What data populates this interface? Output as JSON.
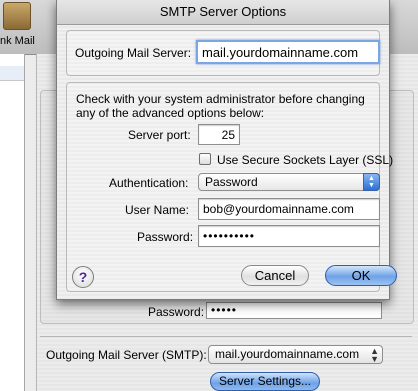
{
  "background": {
    "toolbar_label": "nk Mail",
    "password_label": "Password:",
    "password_value": "•••••",
    "smtp_label": "Outgoing Mail Server (SMTP):",
    "smtp_selected": "mail.yourdomainname.com",
    "server_settings_button": "Server Settings..."
  },
  "dialog": {
    "title": "SMTP Server Options",
    "outgoing_label": "Outgoing Mail Server:",
    "outgoing_value": "mail.yourdomainname.com",
    "note": "Check with your system administrator before changing any of the advanced options below:",
    "server_port_label": "Server port:",
    "server_port_value": "25",
    "ssl_label": "Use Secure Sockets Layer (SSL)",
    "ssl_checked": false,
    "auth_label": "Authentication:",
    "auth_value": "Password",
    "username_label": "User Name:",
    "username_value": "bob@yourdomainname.com",
    "password_label": "Password:",
    "password_value": "••••••••••",
    "help_label": "?",
    "cancel_label": "Cancel",
    "ok_label": "OK"
  },
  "colors": {
    "default_button": "#6fa2e6",
    "focus_ring": "#7ba6e3",
    "help_glyph": "#4a2a8e"
  }
}
